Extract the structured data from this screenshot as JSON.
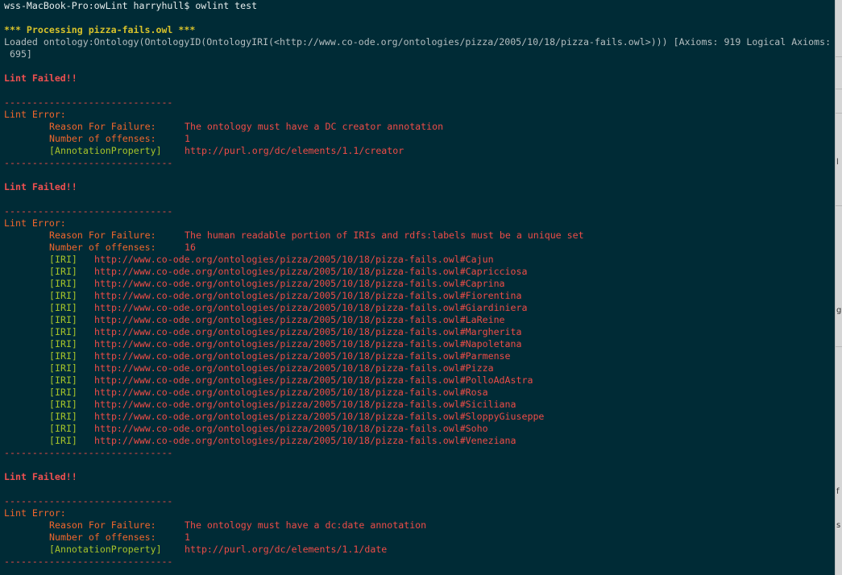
{
  "prompt": {
    "text": "wss-MacBook-Pro:owLint harryhull$ owlint test"
  },
  "processing": {
    "header": "*** Processing pizza-fails.owl ***",
    "loaded_line1": "Loaded ontology:Ontology(OntologyID(OntologyIRI(<http://www.co-ode.org/ontologies/pizza/2005/10/18/pizza-fails.owl>))) [Axioms: 919 Logical Axioms:",
    "loaded_line2": " 695]"
  },
  "lint_failed_label": "Lint Failed!!",
  "separator": "------------------------------",
  "lint_error_label": "Lint Error:",
  "reason_label": "Reason For Failure:",
  "offenses_label": "Number of offenses:",
  "errors": [
    {
      "reason": "The ontology must have a DC creator annotation",
      "offenses": "1",
      "entries": [
        {
          "tag": "[AnnotationProperty]",
          "value": "http://purl.org/dc/elements/1.1/creator"
        }
      ]
    },
    {
      "reason": "The human readable portion of IRIs and rdfs:labels must be a unique set",
      "offenses": "16",
      "entries": [
        {
          "tag": "[IRI]",
          "value": "http://www.co-ode.org/ontologies/pizza/2005/10/18/pizza-fails.owl#Cajun"
        },
        {
          "tag": "[IRI]",
          "value": "http://www.co-ode.org/ontologies/pizza/2005/10/18/pizza-fails.owl#Capricciosa"
        },
        {
          "tag": "[IRI]",
          "value": "http://www.co-ode.org/ontologies/pizza/2005/10/18/pizza-fails.owl#Caprina"
        },
        {
          "tag": "[IRI]",
          "value": "http://www.co-ode.org/ontologies/pizza/2005/10/18/pizza-fails.owl#Fiorentina"
        },
        {
          "tag": "[IRI]",
          "value": "http://www.co-ode.org/ontologies/pizza/2005/10/18/pizza-fails.owl#Giardiniera"
        },
        {
          "tag": "[IRI]",
          "value": "http://www.co-ode.org/ontologies/pizza/2005/10/18/pizza-fails.owl#LaReine"
        },
        {
          "tag": "[IRI]",
          "value": "http://www.co-ode.org/ontologies/pizza/2005/10/18/pizza-fails.owl#Margherita"
        },
        {
          "tag": "[IRI]",
          "value": "http://www.co-ode.org/ontologies/pizza/2005/10/18/pizza-fails.owl#Napoletana"
        },
        {
          "tag": "[IRI]",
          "value": "http://www.co-ode.org/ontologies/pizza/2005/10/18/pizza-fails.owl#Parmense"
        },
        {
          "tag": "[IRI]",
          "value": "http://www.co-ode.org/ontologies/pizza/2005/10/18/pizza-fails.owl#Pizza"
        },
        {
          "tag": "[IRI]",
          "value": "http://www.co-ode.org/ontologies/pizza/2005/10/18/pizza-fails.owl#PolloAdAstra"
        },
        {
          "tag": "[IRI]",
          "value": "http://www.co-ode.org/ontologies/pizza/2005/10/18/pizza-fails.owl#Rosa"
        },
        {
          "tag": "[IRI]",
          "value": "http://www.co-ode.org/ontologies/pizza/2005/10/18/pizza-fails.owl#Siciliana"
        },
        {
          "tag": "[IRI]",
          "value": "http://www.co-ode.org/ontologies/pizza/2005/10/18/pizza-fails.owl#SloppyGiuseppe"
        },
        {
          "tag": "[IRI]",
          "value": "http://www.co-ode.org/ontologies/pizza/2005/10/18/pizza-fails.owl#Soho"
        },
        {
          "tag": "[IRI]",
          "value": "http://www.co-ode.org/ontologies/pizza/2005/10/18/pizza-fails.owl#Veneziana"
        }
      ]
    },
    {
      "reason": "The ontology must have a dc:date annotation",
      "offenses": "1",
      "entries": [
        {
          "tag": "[AnnotationProperty]",
          "value": "http://purl.org/dc/elements/1.1/date"
        }
      ]
    }
  ],
  "side_strip": {
    "glyphs": [
      "l",
      "g",
      "f",
      "s"
    ]
  },
  "colors": {
    "background": "#002b36",
    "header_yellow": "#d7c22b",
    "fail_red": "#ef5050",
    "text_orange_red": "#ee4c47",
    "tag_green": "#a6c32a"
  }
}
